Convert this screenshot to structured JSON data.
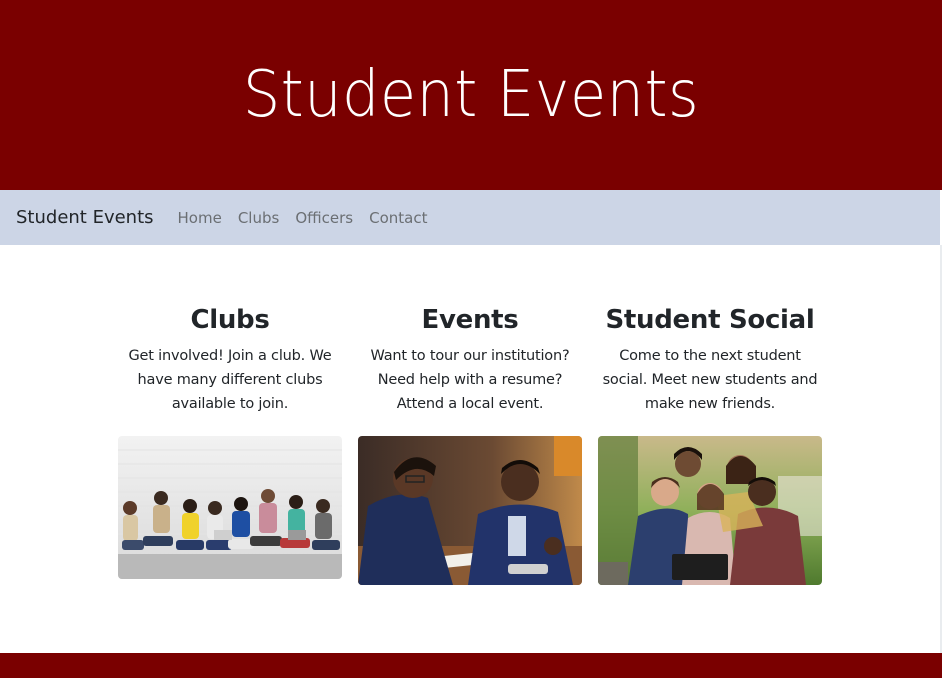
{
  "hero": {
    "title": "Student Events"
  },
  "navbar": {
    "brand": "Student Events",
    "links": [
      {
        "label": "Home"
      },
      {
        "label": "Clubs"
      },
      {
        "label": "Officers"
      },
      {
        "label": "Contact"
      }
    ]
  },
  "cards": [
    {
      "title": "Clubs",
      "text": "Get involved! Join a club. We have many different clubs available to join.",
      "image": "students-sitting-on-floor-photo"
    },
    {
      "title": "Events",
      "text": "Want to tour our institution? Need help with a resume? Attend a local event.",
      "image": "students-studying-photo"
    },
    {
      "title": "Student Social",
      "text": "Come to the next student social. Meet new students and make new friends.",
      "image": "students-group-outdoors-photo"
    }
  ],
  "colors": {
    "hero_bg": "#7a0000",
    "navbar_bg": "#ccd5e6",
    "footer_bg": "#7a0000"
  }
}
